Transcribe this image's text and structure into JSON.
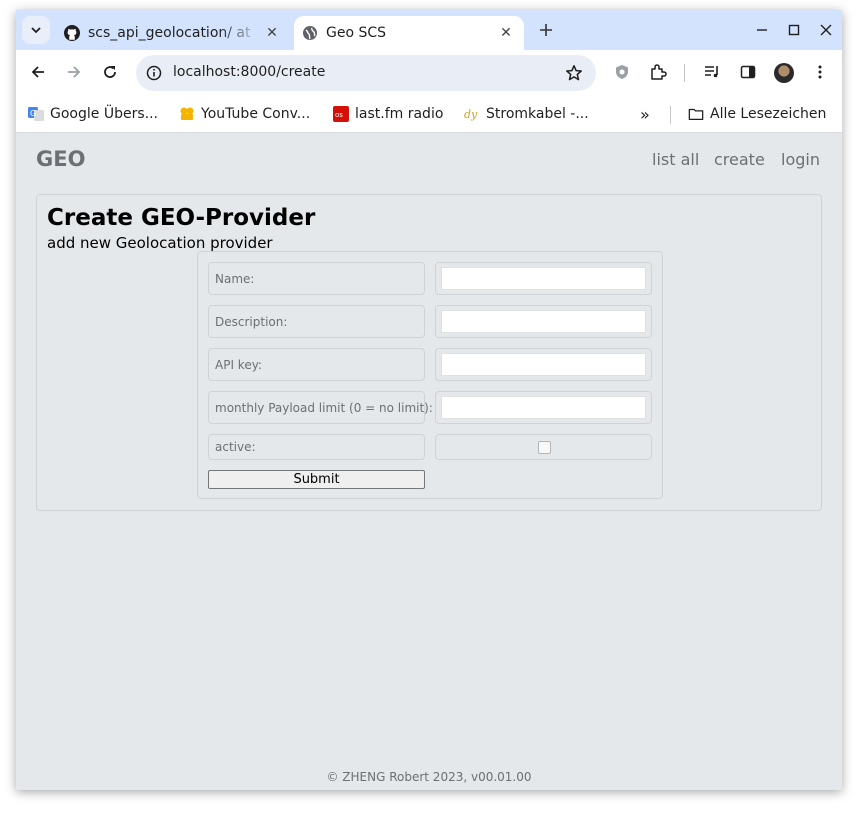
{
  "browser": {
    "tabs": [
      {
        "title": "scs_api_geolocation/ at",
        "favicon": "github-icon",
        "active": false
      },
      {
        "title": "Geo SCS",
        "favicon": "globe-icon",
        "active": true
      }
    ],
    "url": "localhost:8000/create",
    "bookmarks": [
      {
        "label": "Google Übers...",
        "icon": "google-translate-icon"
      },
      {
        "label": "YouTube Conv...",
        "icon": "youtube-converter-icon"
      },
      {
        "label": "last.fm radio",
        "icon": "lastfm-icon"
      },
      {
        "label": "Stromkabel -...",
        "icon": "stromkabel-icon"
      }
    ],
    "all_bookmarks_label": "Alle Lesezeichen",
    "overflow_label": "»"
  },
  "page": {
    "brand": "GEO",
    "nav": [
      "list all",
      "create",
      "login"
    ],
    "heading": "Create GEO-Provider",
    "subheading": "add new Geolocation provider",
    "form": {
      "fields": [
        {
          "label": "Name:",
          "value": ""
        },
        {
          "label": "Description:",
          "value": ""
        },
        {
          "label": "API key:",
          "value": ""
        },
        {
          "label": "monthly Payload limit (0 = no limit):",
          "value": ""
        }
      ],
      "active_label": "active:",
      "active_checked": false,
      "submit_label": "Submit"
    },
    "footer": "© ZHENG Robert 2023, v00.01.00"
  },
  "colors": {
    "tabstrip": "#d3e3fd",
    "page_bg": "#e5e8eb",
    "muted_text": "#6c6f73"
  }
}
